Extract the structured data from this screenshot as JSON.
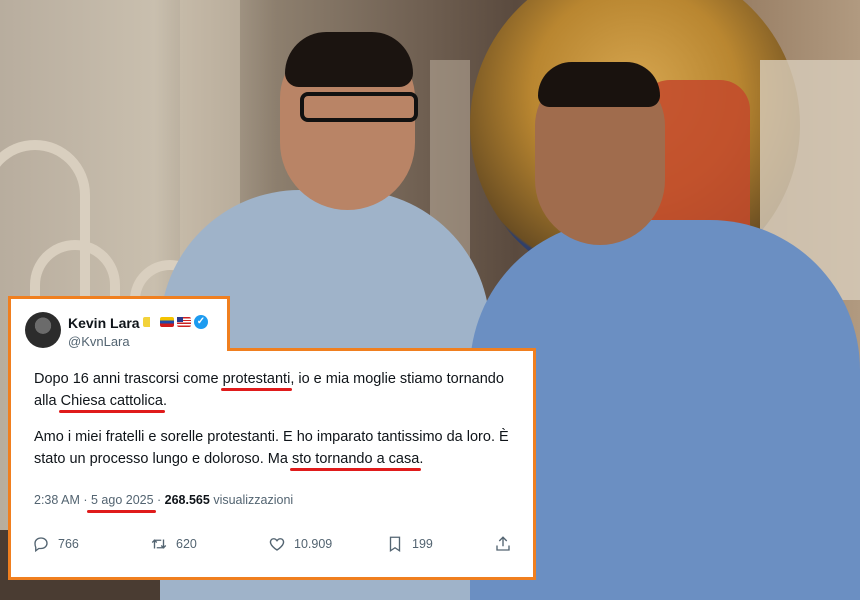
{
  "tweet": {
    "author_name": "Kevin Lara",
    "handle": "@KvnLara",
    "icons": [
      "vatican-flag-icon",
      "venezuela-flag-icon",
      "us-flag-icon",
      "verified-badge-icon"
    ],
    "verified_glyph": "✓",
    "para1": {
      "part1": "Dopo 16 anni trascorsi come ",
      "highlight1": "protestanti",
      "part2": ", io e mia moglie stiamo tornando alla ",
      "highlight2": "Chiesa cattolica",
      "part3": "."
    },
    "para2": {
      "part1": "Amo i miei fratelli e sorelle protestanti. E ho imparato tantissimo da loro. È stato un processo lungo e doloroso. Ma ",
      "highlight": "sto tornando a casa",
      "part2": "."
    },
    "time": "2:38 AM",
    "separator": " · ",
    "date": "5 ago 2025",
    "views_count": "268.565",
    "views_label": " visualizzazioni",
    "replies": "766",
    "reposts": "620",
    "likes": "10.909",
    "bookmarks": "199"
  },
  "colors": {
    "frame_border": "#f07f1f",
    "underline": "#e01b1b",
    "verified": "#1d9bf0",
    "text_primary": "#0f1419",
    "text_secondary": "#536471"
  }
}
